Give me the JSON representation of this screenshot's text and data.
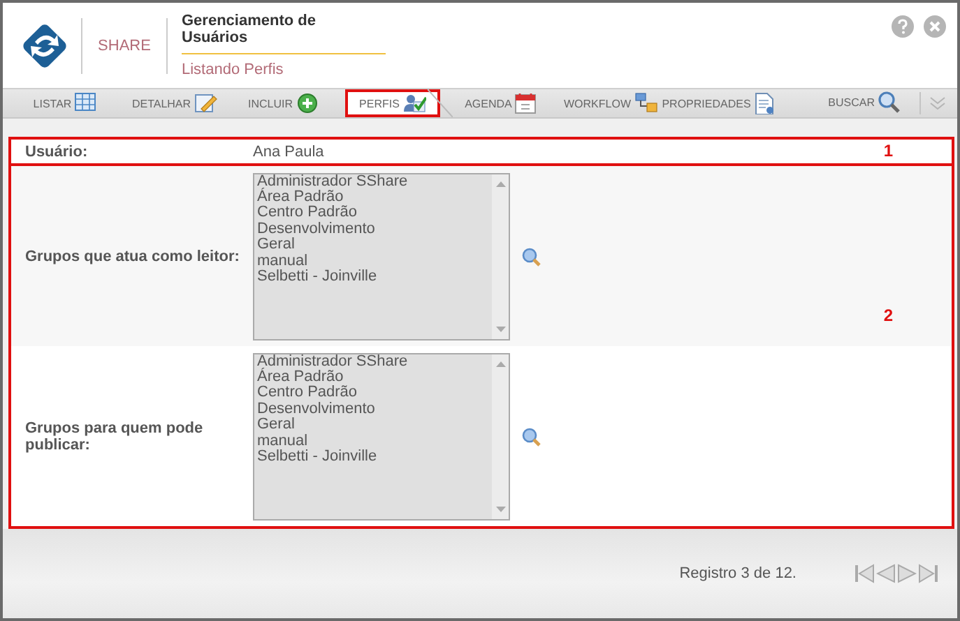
{
  "header": {
    "logo_text": "SHARE",
    "title": "Gerenciamento de Usuários",
    "subtitle": "Listando Perfis"
  },
  "toolbar": [
    {
      "label": "LISTAR",
      "kind": "grid",
      "selected": false
    },
    {
      "label": "DETALHAR",
      "kind": "edit",
      "selected": false
    },
    {
      "label": "INCLUIR",
      "kind": "add",
      "selected": false
    },
    {
      "label": "PERFIS",
      "kind": "profile",
      "selected": true
    },
    {
      "label": "AGENDA",
      "kind": "calendar",
      "selected": false
    },
    {
      "label": "WORKFLOW",
      "kind": "flow",
      "selected": false
    },
    {
      "label": "PROPRIEDADES",
      "kind": "document",
      "selected": false
    }
  ],
  "search": {
    "label": "BUSCAR"
  },
  "user": {
    "annotation": "1",
    "label": "Usuário:",
    "value": "Ana Paula"
  },
  "groups_annotation": "2",
  "groups": [
    {
      "label": "Grupos que atua como leitor:",
      "items": [
        "Administrador SShare",
        "Área Padrão",
        "Centro Padrão",
        "Desenvolvimento",
        "Geral",
        "manual",
        "Selbetti - Joinville"
      ]
    },
    {
      "label": "Grupos para quem pode publicar:",
      "items": [
        "Administrador SShare",
        "Área Padrão",
        "Centro Padrão",
        "Desenvolvimento",
        "Geral",
        "manual",
        "Selbetti - Joinville"
      ]
    }
  ],
  "status": "Registro 3 de 12."
}
